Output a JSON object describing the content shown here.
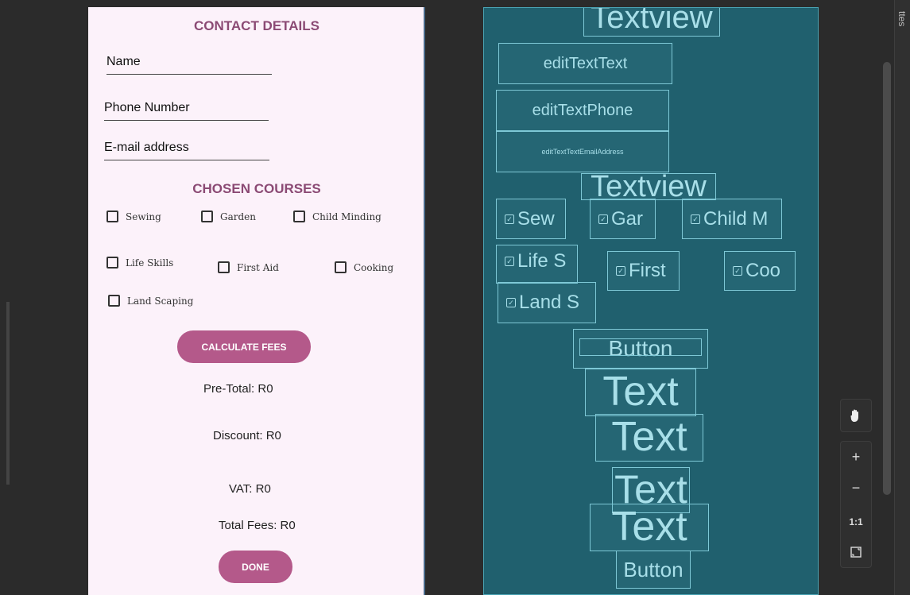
{
  "design": {
    "contact_heading": "CONTACT DETAILS",
    "fields": {
      "name": "Name",
      "phone": "Phone Number",
      "email": "E-mail address"
    },
    "courses_heading": "CHOSEN COURSES",
    "courses": [
      "Sewing",
      "Garden",
      "Child Minding",
      "Life Skills",
      "First Aid",
      "Cooking",
      "Land Scaping"
    ],
    "calculate_button": "CALCULATE FEES",
    "pre_total": "Pre-Total: R0",
    "discount": "Discount: R0",
    "vat": "VAT: R0",
    "total_fees": "Total Fees: R0",
    "done_button": "DONE"
  },
  "blueprint": {
    "textview_top": "Textview",
    "edit_text": "editTextText",
    "edit_phone": "editTextPhone",
    "edit_email": "editTextTextEmailAddress",
    "textview_courses": "Textview",
    "cb_sewing": "Sew",
    "cb_garden": "Gar",
    "cb_child": "Child M",
    "cb_life": "Life S",
    "cb_first": "First",
    "cb_cooking": "Coo",
    "cb_land": "Land S",
    "button_calc": "Button",
    "text1": "Text",
    "text2": "Text",
    "text3": "Text",
    "text4": "Text",
    "button_done": "Button"
  },
  "tools": {
    "pan_icon": "hand-icon",
    "zoom_in": "+",
    "zoom_out": "−",
    "zoom_reset": "1:1",
    "fit_icon": "fit-screen-icon",
    "side_tab": "ttes"
  },
  "colors": {
    "accent": "#b4598a",
    "heading": "#8b4a74",
    "blueprint": "#20606e"
  }
}
